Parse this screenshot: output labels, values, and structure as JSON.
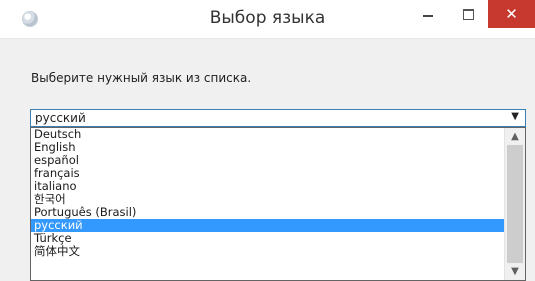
{
  "window": {
    "title": "Выбор языка",
    "close_label": "✕"
  },
  "prompt": "Выберите нужный язык из списка.",
  "select": {
    "value": "русский",
    "arrow": "▼"
  },
  "list": {
    "items": [
      "Deutsch",
      "English",
      "español",
      "français",
      "italiano",
      "한국어",
      "Português (Brasil)",
      "русский",
      "Türkçe",
      "简体中文"
    ],
    "selected_index": 7
  },
  "scrollbar": {
    "up": "▲",
    "down": "▼"
  },
  "colors": {
    "accent": "#3399ff",
    "close_button": "#c7392e",
    "select_border": "#3c7fb1"
  }
}
